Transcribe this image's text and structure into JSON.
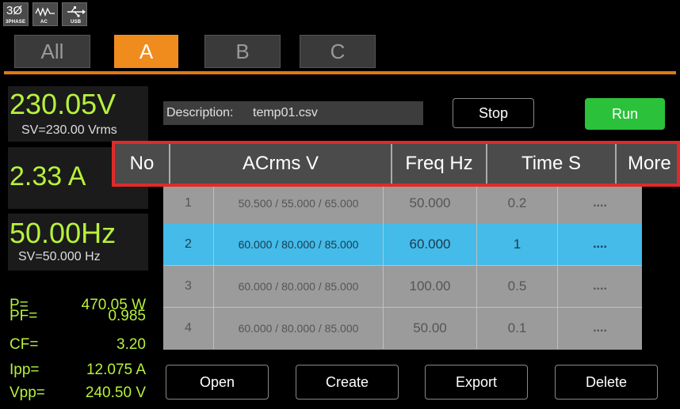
{
  "status_icons": [
    {
      "big": "3Ø",
      "small": "3PHASE",
      "icon": "three-phase-icon"
    },
    {
      "big": "∿∿",
      "small": "AC",
      "icon": "ac-waveform-icon"
    },
    {
      "big": "⭠",
      "small": "USB",
      "icon": "usb-icon"
    }
  ],
  "tabs": [
    "All",
    "A",
    "B",
    "C"
  ],
  "active_tab": "A",
  "readouts": {
    "voltage": "230.05V",
    "voltage_sv": "SV=230.00 Vrms",
    "current": "2.33 A",
    "frequency": "50.00Hz",
    "frequency_sv": "SV=50.000  Hz"
  },
  "measurements": [
    {
      "key": "P=",
      "value": "470.05 W"
    },
    {
      "key": "PF=",
      "value": "0.985"
    },
    {
      "key": "CF=",
      "value": "3.20"
    },
    {
      "key": "Ipp=",
      "value": "12.075 A"
    },
    {
      "key": "Vpp=",
      "value": "240.50 V"
    }
  ],
  "description": {
    "label": "Description:",
    "value": "temp01.csv"
  },
  "buttons": {
    "stop": "Stop",
    "run": "Run",
    "open": "Open",
    "create": "Create",
    "export": "Export",
    "delete": "Delete"
  },
  "table": {
    "headers": [
      "No",
      "ACrms V",
      "Freq Hz",
      "Time S",
      "More"
    ],
    "rows": [
      {
        "no": "1",
        "acrms": "50.500 / 55.000 / 65.000",
        "freq": "50.000",
        "time": "0.2",
        "more": "...."
      },
      {
        "no": "2",
        "acrms": "60.000 / 80.000 / 85.000",
        "freq": "60.000",
        "time": "1",
        "more": "...."
      },
      {
        "no": "3",
        "acrms": "60.000 / 80.000 / 85.000",
        "freq": "100.00",
        "time": "0.5",
        "more": "...."
      },
      {
        "no": "4",
        "acrms": "60.000 / 80.000 / 85.000",
        "freq": "50.00",
        "time": "0.1",
        "more": "...."
      }
    ],
    "selected_row": 2
  },
  "colors": {
    "accent_orange": "#f08c1e",
    "readout_green": "#b7f23a",
    "selected_row": "#44bbe8",
    "run_green": "#2cc13a",
    "highlight_red": "#e02a2a"
  }
}
